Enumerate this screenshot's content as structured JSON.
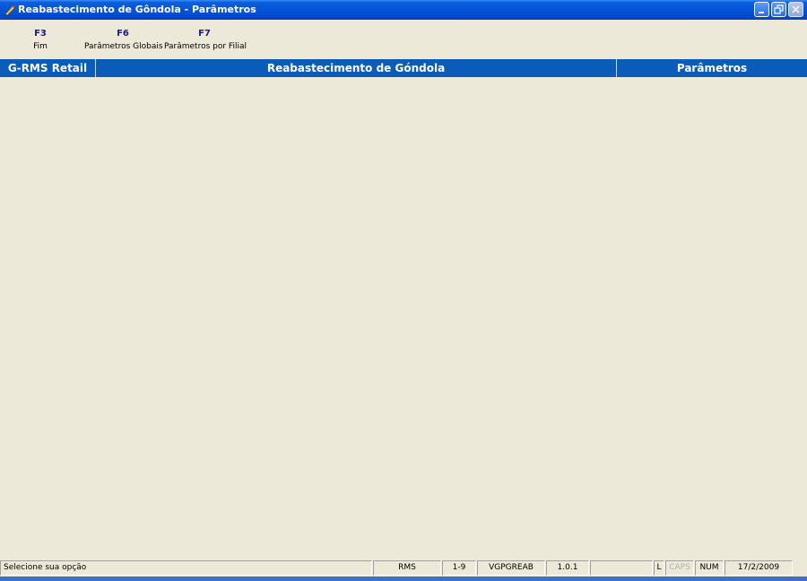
{
  "window": {
    "title": "Reabastecimento de Gôndola - Parâmetros",
    "icon": "app-pen-icon",
    "controls": [
      "minimize-icon",
      "restore-icon",
      "close-icon"
    ]
  },
  "toolbar": {
    "items": [
      {
        "key": "F3",
        "label": "Fim"
      },
      {
        "key": "F6",
        "label": "Parâmetros Globais"
      },
      {
        "key": "F7",
        "label": "Parâmetros por Filial"
      }
    ]
  },
  "header": {
    "system": "G-RMS Retail",
    "module": "Reabastecimento de Góndola",
    "screen": "Parâmetros"
  },
  "statusbar": {
    "message": "Selecione sua opção",
    "system": "RMS",
    "code": "1-9",
    "program": "VGPGREAB",
    "version": "1.0.1",
    "blank": "",
    "l": "L",
    "caps": "CAPS",
    "num": "NUM",
    "date": "17/2/2009"
  },
  "colors": {
    "titlebar": "#0554d8",
    "header_band": "#0b5cb8",
    "background": "#ece9d8",
    "fkey_text": "#1a1a8c"
  }
}
